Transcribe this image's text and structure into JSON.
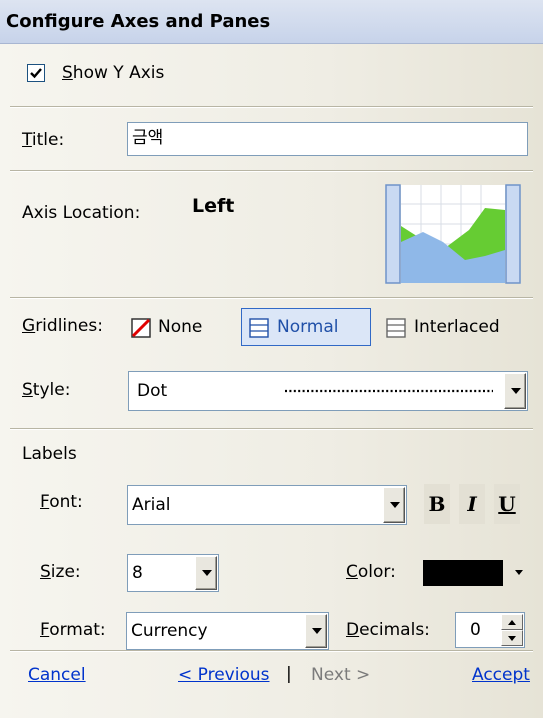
{
  "header": {
    "title": "Configure Axes and Panes"
  },
  "show_axis": {
    "checked": true,
    "label_accesskey": "S",
    "label_rest": "how Y Axis"
  },
  "title_field": {
    "label_accesskey": "T",
    "label_rest": "itle:",
    "value": "금액"
  },
  "axis_location": {
    "label": "Axis Location:",
    "value": "Left"
  },
  "gridlines": {
    "label_accesskey": "G",
    "label_rest": "ridlines:",
    "options": [
      {
        "label": "None",
        "icon": "no-gridlines-icon"
      },
      {
        "label": "Normal",
        "icon": "normal-gridlines-icon",
        "selected": true
      },
      {
        "label": "Interlaced",
        "icon": "interlaced-gridlines-icon"
      }
    ]
  },
  "style": {
    "label_accesskey": "S",
    "label_rest": "tyle:",
    "value": "Dot"
  },
  "labels": {
    "heading": "Labels",
    "font": {
      "label_accesskey": "F",
      "label_rest": "ont:",
      "value": "Arial"
    },
    "bold": "B",
    "italic": "I",
    "underline": "U",
    "size": {
      "label_accesskey": "S",
      "label_rest": "ize:",
      "value": "8"
    },
    "color": {
      "label_accesskey": "C",
      "label_rest": "olor:",
      "value": "#000000"
    },
    "format": {
      "label_accesskey": "F",
      "label_rest": "ormat:",
      "value": "Currency"
    },
    "decimals": {
      "label_accesskey": "D",
      "label_rest": "ecimals:",
      "value": "0"
    }
  },
  "footer": {
    "cancel": "Cancel",
    "previous": "< Previous",
    "divider": "|",
    "next": "Next >",
    "accept": "Accept"
  },
  "colors": {
    "header_bg": "#c7d3ea",
    "selected_border": "#3169c6",
    "link": "#0033cc",
    "chart_area": "#66cc33",
    "chart_fill": "#8fb8e8"
  }
}
